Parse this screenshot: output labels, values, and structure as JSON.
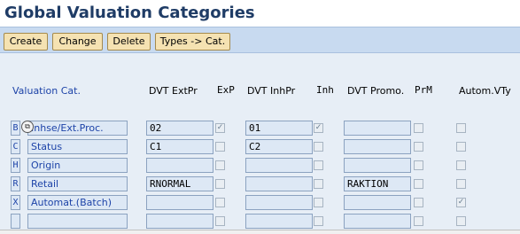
{
  "page": {
    "title": "Global Valuation Categories"
  },
  "toolbar": {
    "buttons": [
      {
        "label": "Create"
      },
      {
        "label": "Change"
      },
      {
        "label": "Delete"
      },
      {
        "label": "Types -> Cat."
      }
    ]
  },
  "table": {
    "headers": {
      "valuation_cat": "Valuation Cat.",
      "dvt_extpr": "DVT ExtPr",
      "exp": "ExP",
      "dvt_inhpr": "DVT InhPr",
      "inh": "Inh",
      "dvt_promo": "DVT Promo.",
      "prm": "PrM",
      "autom_vty": "Autom.VTy"
    },
    "rows": [
      {
        "code": "B",
        "name": "Inhse/Ext.Proc.",
        "dvt_extpr": "02",
        "exp": true,
        "dvt_inhpr": "01",
        "inh": true,
        "dvt_promo": "",
        "prm": false,
        "autom_vty": false
      },
      {
        "code": "C",
        "name": "Status",
        "dvt_extpr": "C1",
        "exp": false,
        "dvt_inhpr": "C2",
        "inh": false,
        "dvt_promo": "",
        "prm": false,
        "autom_vty": false
      },
      {
        "code": "H",
        "name": "Origin",
        "dvt_extpr": "",
        "exp": false,
        "dvt_inhpr": "",
        "inh": false,
        "dvt_promo": "",
        "prm": false,
        "autom_vty": false
      },
      {
        "code": "R",
        "name": "Retail",
        "dvt_extpr": "RNORMAL",
        "exp": false,
        "dvt_inhpr": "",
        "inh": false,
        "dvt_promo": "RAKTION",
        "prm": false,
        "autom_vty": false
      },
      {
        "code": "X",
        "name": "Automat.(Batch)",
        "dvt_extpr": "",
        "exp": false,
        "dvt_inhpr": "",
        "inh": false,
        "dvt_promo": "",
        "prm": false,
        "autom_vty": true
      },
      {
        "code": "",
        "name": "",
        "dvt_extpr": "",
        "exp": false,
        "dvt_inhpr": "",
        "inh": false,
        "dvt_promo": "",
        "prm": false,
        "autom_vty": false
      }
    ]
  },
  "colors": {
    "title": "#1f3c66",
    "toolbar_bg": "#c8daf0",
    "button_bg": "#f5e2b2",
    "field_bg": "#dde8f5",
    "link_blue": "#1d43a8"
  }
}
